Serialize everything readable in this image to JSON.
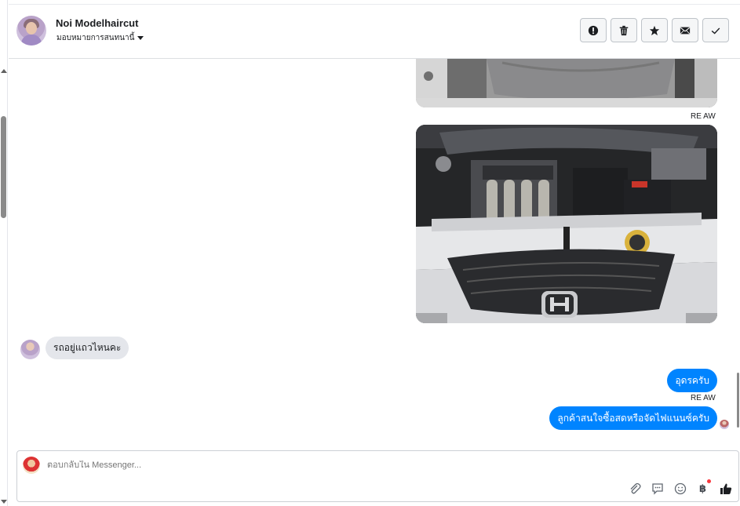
{
  "header": {
    "name": "Noi Modelhaircut",
    "subtitle": "มอบหมายการสนทนานี้",
    "buttons": [
      {
        "icon": "alert-icon",
        "label": "spam"
      },
      {
        "icon": "trash-icon",
        "label": "delete"
      },
      {
        "icon": "star-icon",
        "label": "follow up"
      },
      {
        "icon": "envelope-icon",
        "label": "mark unread"
      },
      {
        "icon": "check-icon",
        "label": "done"
      }
    ]
  },
  "messages": {
    "seen_label_1": "RE AW",
    "incoming_text": "รถอยู่แถวไหนคะ",
    "outgoing_1": "อุดรครับ",
    "seen_label_2": "RE AW",
    "outgoing_2": "ลูกค้าสนใจซื้อสดหรือจัดไฟแนนซ์ครับ"
  },
  "composer": {
    "placeholder": "ตอบกลับใน Messenger...",
    "tools": [
      "attach-icon",
      "saved-reply-icon",
      "emoji-icon",
      "payment-icon",
      "like-icon"
    ],
    "payment_symbol": "฿"
  },
  "colors": {
    "accent": "#0084ff",
    "incoming_bubble": "#e4e6eb",
    "notification_dot": "#fa383e"
  }
}
